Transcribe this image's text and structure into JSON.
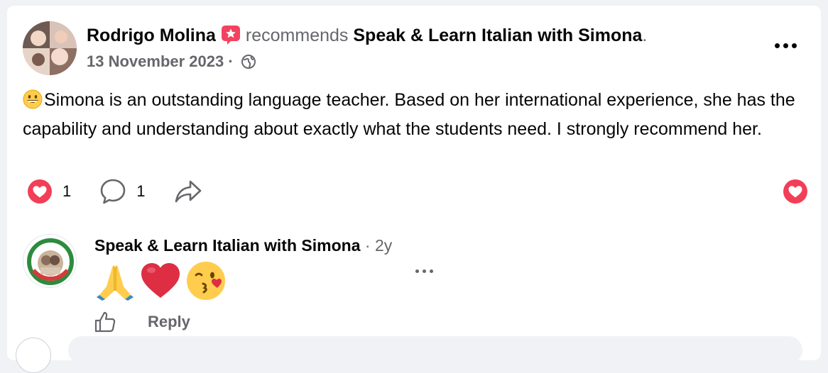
{
  "post": {
    "author": "Rodrigo Molina",
    "verb": "recommends",
    "page_name": "Speak & Learn Italian with Simona",
    "period": ".",
    "date": "13 November 2023",
    "separator": " · ",
    "text": "Simona is an outstanding language teacher. Based on her international experience, she has the capability and understanding about exactly what the students need. I strongly recommend her.",
    "reaction_count": "1",
    "comment_count": "1"
  },
  "comment": {
    "author": "Speak & Learn Italian with Simona",
    "separator": " · ",
    "time": "2y",
    "emojis": [
      "folded-hands-emoji",
      "red-heart-emoji",
      "kissing-face-emoji"
    ],
    "reply_label": "Reply"
  },
  "colors": {
    "heart_red": "#f33e58",
    "muted_text": "#65676b",
    "recommend_badge": "#f3425f"
  }
}
